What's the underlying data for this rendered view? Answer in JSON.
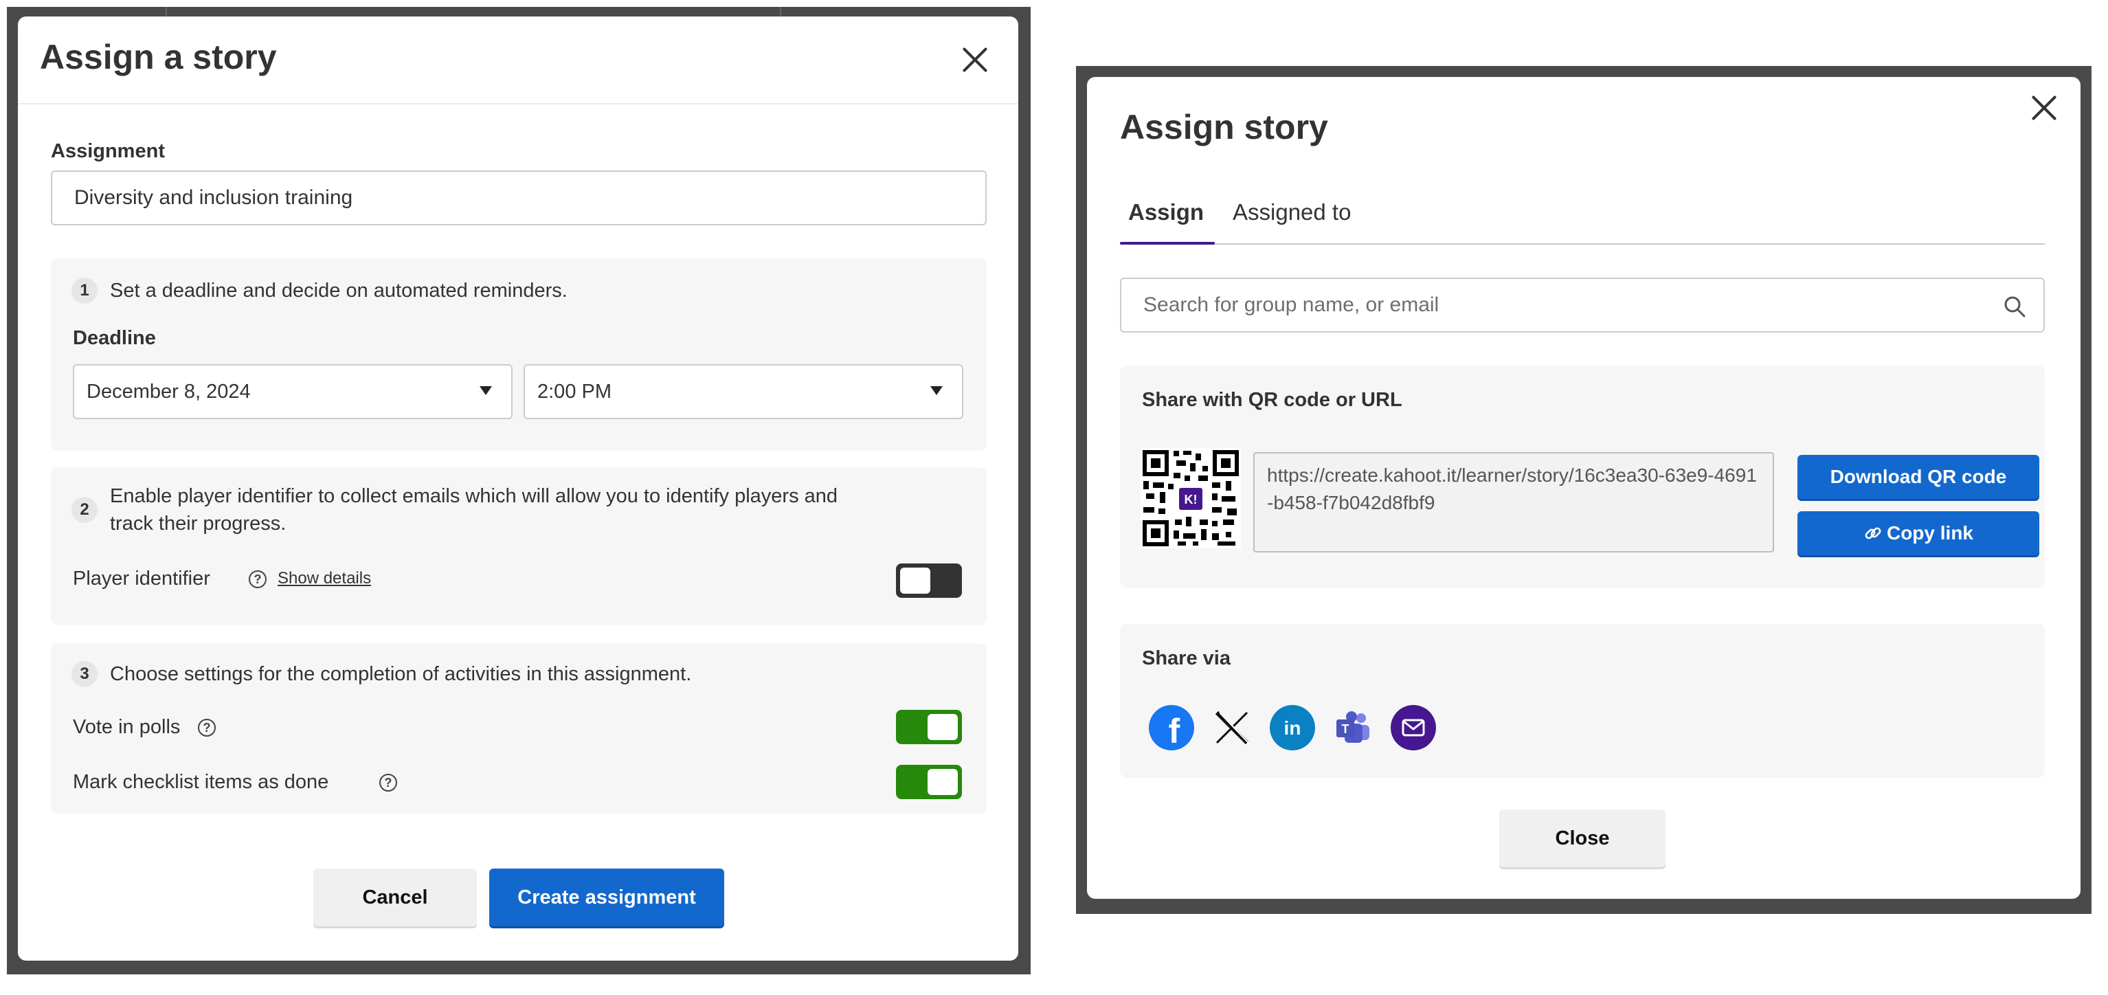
{
  "assign_modal": {
    "title": "Assign a story",
    "assignment_label": "Assignment",
    "assignment_value": "Diversity and inclusion training",
    "step1": {
      "number": "1",
      "text": "Set a deadline and decide on automated reminders.",
      "deadline_label": "Deadline",
      "date_value": "December 8, 2024",
      "time_value": "2:00 PM"
    },
    "step2": {
      "number": "2",
      "text_line1": "Enable player identifier to collect emails which will allow you to identify players and",
      "text_line2": "track their progress.",
      "player_identifier_label": "Player identifier",
      "show_details": "Show details",
      "player_identifier_on": false
    },
    "step3": {
      "number": "3",
      "text": "Choose settings for the completion of activities in this assignment.",
      "vote_label": "Vote in polls",
      "vote_on": true,
      "checklist_label": "Mark checklist items as done",
      "checklist_on": true
    },
    "cancel_label": "Cancel",
    "create_label": "Create assignment"
  },
  "share_modal": {
    "title": "Assign story",
    "tabs": [
      {
        "label": "Assign",
        "active": true
      },
      {
        "label": "Assigned to",
        "active": false
      }
    ],
    "search_placeholder": "Search for group name, or email",
    "qr_section_title": "Share with QR code or URL",
    "url": "https://create.kahoot.it/learner/story/16c3ea30-63e9-4691-b458-f7b042d8fbf9",
    "qr_badge": "K!",
    "download_label": "Download QR code",
    "copy_label": "Copy link",
    "share_via_title": "Share via",
    "share_icons": [
      "facebook-icon",
      "x-icon",
      "linkedin-icon",
      "teams-icon",
      "email-icon"
    ],
    "close_label": "Close"
  },
  "colors": {
    "primary_blue": "#1368ce",
    "toggle_green": "#26890c",
    "tab_purple": "#46178f"
  }
}
